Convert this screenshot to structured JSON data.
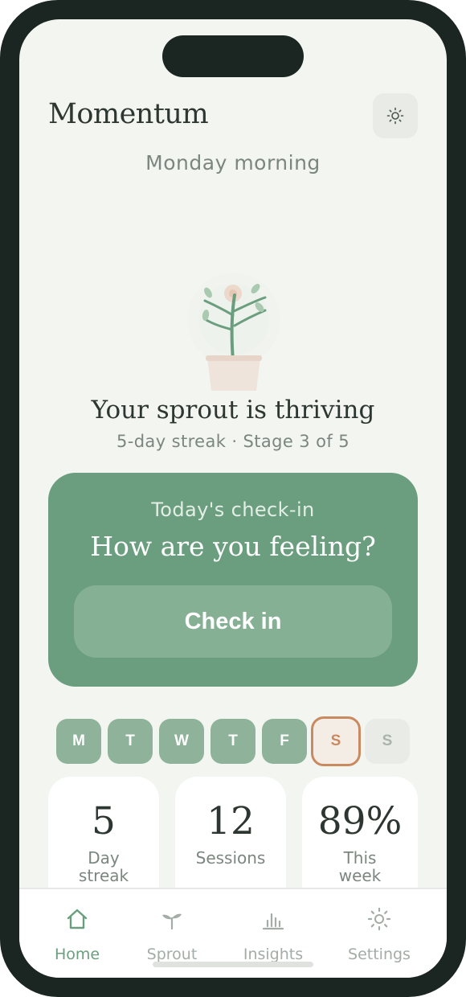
{
  "app": {
    "title": "Momentum",
    "greeting": "Monday morning",
    "theme_icon": "sun-icon"
  },
  "status": {
    "title": "Your sprout is thriving",
    "subtitle": "5-day streak · Stage 3 of 5",
    "stage": 3,
    "stage_total": 5
  },
  "checkin": {
    "label": "Today's check-in",
    "question": "How are you feeling?",
    "button": "Check in"
  },
  "week": {
    "days": [
      {
        "letter": "M",
        "state": "done"
      },
      {
        "letter": "T",
        "state": "done"
      },
      {
        "letter": "W",
        "state": "done"
      },
      {
        "letter": "T",
        "state": "done"
      },
      {
        "letter": "F",
        "state": "done"
      },
      {
        "letter": "S",
        "state": "today"
      },
      {
        "letter": "S",
        "state": "future"
      }
    ]
  },
  "stats": [
    {
      "value": "5",
      "label": "Day streak"
    },
    {
      "value": "12",
      "label": "Sessions"
    },
    {
      "value": "89%",
      "label": "This week"
    }
  ],
  "tabs": [
    {
      "label": "Home",
      "icon": "home-icon",
      "active": true
    },
    {
      "label": "Sprout",
      "icon": "sprout-icon",
      "active": false
    },
    {
      "label": "Insights",
      "icon": "bar-chart-icon",
      "active": false
    },
    {
      "label": "Settings",
      "icon": "gear-icon",
      "active": false
    }
  ],
  "colors": {
    "accent": "#6b9e7e",
    "accent_light": "#8fb29a",
    "today": "#c98a62",
    "background": "#f3f5f1",
    "text_muted": "#7c8680",
    "tab_inactive": "#a3aca6"
  }
}
